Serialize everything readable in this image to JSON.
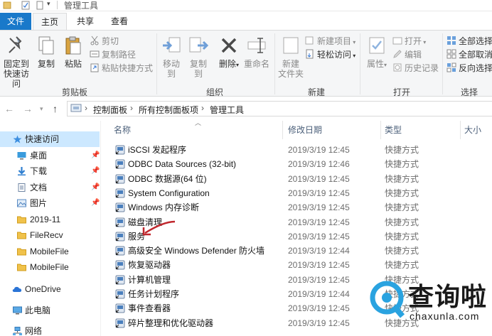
{
  "window": {
    "title": "管理工具"
  },
  "ribbon_tabs": [
    "文件",
    "主页",
    "共享",
    "查看"
  ],
  "ribbon": {
    "clipboard": {
      "pin_label_line1": "固定到",
      "pin_label_line2": "快速访问",
      "copy_label": "复制",
      "paste_label": "粘贴",
      "cut_label": "剪切",
      "copy_path_label": "复制路径",
      "paste_shortcut_label": "粘贴快捷方式",
      "group_label": "剪贴板"
    },
    "organize": {
      "move_to_label": "移动到",
      "copy_to_label": "复制到",
      "delete_label": "删除",
      "rename_label": "重命名",
      "group_label": "组织"
    },
    "new": {
      "new_folder_line1": "新建",
      "new_folder_line2": "文件夹",
      "new_item_label": "新建项目",
      "easy_access_label": "轻松访问",
      "group_label": "新建"
    },
    "open": {
      "properties_label": "属性",
      "open_label": "打开",
      "edit_label": "编辑",
      "history_label": "历史记录",
      "group_label": "打开"
    },
    "select": {
      "select_all_label": "全部选择",
      "select_none_label": "全部取消",
      "invert_label": "反向选择",
      "group_label": "选择"
    }
  },
  "address": {
    "crumbs": [
      "控制面板",
      "所有控制面板项",
      "管理工具"
    ]
  },
  "sidebar": {
    "items": [
      {
        "label": "快速访问",
        "icon": "star-icon",
        "pinned": false
      },
      {
        "label": "桌面",
        "icon": "desktop-icon",
        "pinned": true
      },
      {
        "label": "下载",
        "icon": "download-icon",
        "pinned": true
      },
      {
        "label": "文档",
        "icon": "document-icon",
        "pinned": true
      },
      {
        "label": "图片",
        "icon": "picture-icon",
        "pinned": true
      },
      {
        "label": "2019-11",
        "icon": "folder-icon",
        "pinned": false
      },
      {
        "label": "FileRecv",
        "icon": "folder-icon",
        "pinned": false
      },
      {
        "label": "MobileFile",
        "icon": "folder-icon",
        "pinned": false
      },
      {
        "label": "MobileFile",
        "icon": "folder-icon",
        "pinned": false
      },
      {
        "label": "OneDrive",
        "icon": "cloud-icon",
        "pinned": false
      },
      {
        "label": "此电脑",
        "icon": "computer-icon",
        "pinned": false
      },
      {
        "label": "网络",
        "icon": "network-icon",
        "pinned": false
      }
    ]
  },
  "columns": {
    "name": "名称",
    "date": "修改日期",
    "type": "类型",
    "size": "大小"
  },
  "files": [
    {
      "name": "iSCSI 发起程序",
      "date": "2019/3/19 12:45",
      "type": "快捷方式"
    },
    {
      "name": "ODBC Data Sources (32-bit)",
      "date": "2019/3/19 12:46",
      "type": "快捷方式"
    },
    {
      "name": "ODBC 数据源(64 位)",
      "date": "2019/3/19 12:45",
      "type": "快捷方式"
    },
    {
      "name": "System Configuration",
      "date": "2019/3/19 12:45",
      "type": "快捷方式"
    },
    {
      "name": "Windows 内存诊断",
      "date": "2019/3/19 12:45",
      "type": "快捷方式"
    },
    {
      "name": "磁盘清理",
      "date": "2019/3/19 12:45",
      "type": "快捷方式"
    },
    {
      "name": "服务",
      "date": "2019/3/19 12:45",
      "type": "快捷方式"
    },
    {
      "name": "高级安全 Windows Defender 防火墙",
      "date": "2019/3/19 12:44",
      "type": "快捷方式"
    },
    {
      "name": "恢复驱动器",
      "date": "2019/3/19 12:45",
      "type": "快捷方式"
    },
    {
      "name": "计算机管理",
      "date": "2019/3/19 12:45",
      "type": "快捷方式"
    },
    {
      "name": "任务计划程序",
      "date": "2019/3/19 12:44",
      "type": "快捷方式"
    },
    {
      "name": "事件查看器",
      "date": "2019/3/19 12:45",
      "type": "快捷方式"
    },
    {
      "name": "碎片整理和优化驱动器",
      "date": "2019/3/19 12:45",
      "type": "快捷方式"
    }
  ],
  "watermark": {
    "text": "查询啦",
    "domain": "chaxunla.com"
  },
  "colors": {
    "accent": "#1979ca",
    "selection": "#cce8ff",
    "annotation": "#c0272d"
  }
}
